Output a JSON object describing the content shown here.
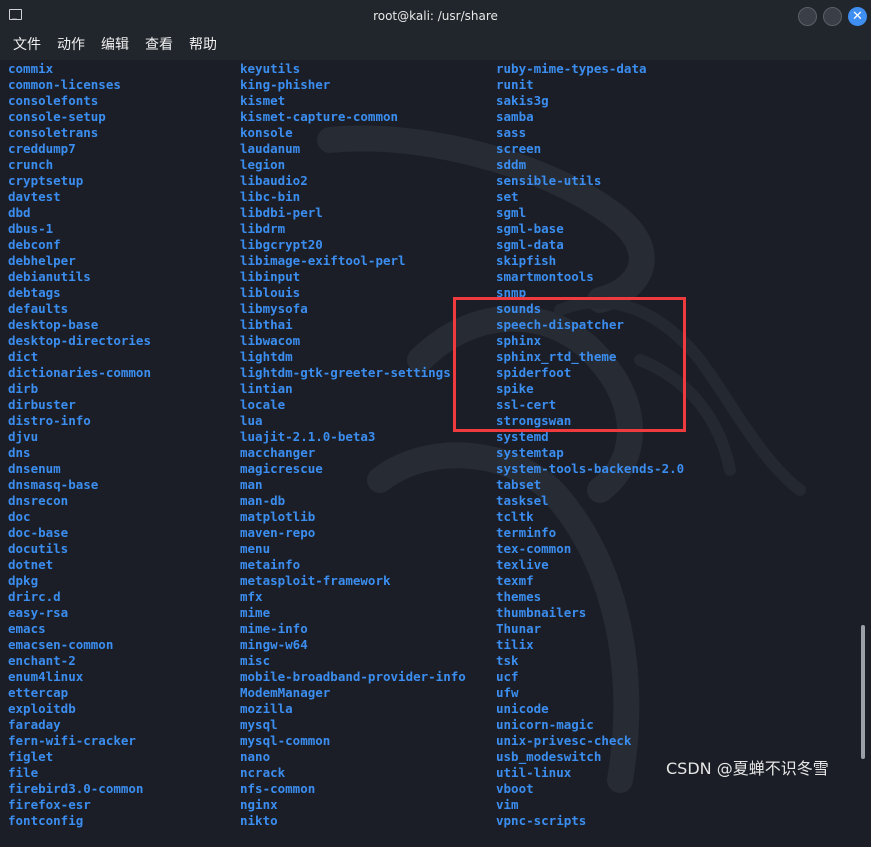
{
  "window": {
    "title": "root@kali: /usr/share",
    "app_icon": "terminal-icon",
    "buttons": [
      "minimize-button",
      "maximize-button",
      "close-button"
    ],
    "close_glyph": "✕"
  },
  "menu": {
    "items": [
      "文件",
      "动作",
      "编辑",
      "查看",
      "帮助"
    ]
  },
  "listing": {
    "color": "#3b8ef0",
    "col1": [
      "commix",
      "common-licenses",
      "consolefonts",
      "console-setup",
      "consoletrans",
      "creddump7",
      "crunch",
      "cryptsetup",
      "davtest",
      "dbd",
      "dbus-1",
      "debconf",
      "debhelper",
      "debianutils",
      "debtags",
      "defaults",
      "desktop-base",
      "desktop-directories",
      "dict",
      "dictionaries-common",
      "dirb",
      "dirbuster",
      "distro-info",
      "djvu",
      "dns",
      "dnsenum",
      "dnsmasq-base",
      "dnsrecon",
      "doc",
      "doc-base",
      "docutils",
      "dotnet",
      "dpkg",
      "drirc.d",
      "easy-rsa",
      "emacs",
      "emacsen-common",
      "enchant-2",
      "enum4linux",
      "ettercap",
      "exploitdb",
      "faraday",
      "fern-wifi-cracker",
      "figlet",
      "file",
      "firebird3.0-common",
      "firefox-esr",
      "fontconfig"
    ],
    "col2": [
      "keyutils",
      "king-phisher",
      "kismet",
      "kismet-capture-common",
      "konsole",
      "laudanum",
      "legion",
      "libaudio2",
      "libc-bin",
      "libdbi-perl",
      "libdrm",
      "libgcrypt20",
      "libimage-exiftool-perl",
      "libinput",
      "liblouis",
      "libmysofa",
      "libthai",
      "libwacom",
      "lightdm",
      "lightdm-gtk-greeter-settings",
      "lintian",
      "locale",
      "lua",
      "luajit-2.1.0-beta3",
      "macchanger",
      "magicrescue",
      "man",
      "man-db",
      "matplotlib",
      "maven-repo",
      "menu",
      "metainfo",
      "metasploit-framework",
      "mfx",
      "mime",
      "mime-info",
      "mingw-w64",
      "misc",
      "mobile-broadband-provider-info",
      "ModemManager",
      "mozilla",
      "mysql",
      "mysql-common",
      "nano",
      "ncrack",
      "nfs-common",
      "nginx",
      "nikto"
    ],
    "col3": [
      "ruby-mime-types-data",
      "runit",
      "sakis3g",
      "samba",
      "sass",
      "screen",
      "sddm",
      "sensible-utils",
      "set",
      "sgml",
      "sgml-base",
      "sgml-data",
      "skipfish",
      "smartmontools",
      "snmp",
      "sounds",
      "speech-dispatcher",
      "sphinx",
      "sphinx_rtd_theme",
      "spiderfoot",
      "spike",
      "ssl-cert",
      "strongswan",
      "systemd",
      "systemtap",
      "system-tools-backends-2.0",
      "tabset",
      "tasksel",
      "tcltk",
      "terminfo",
      "tex-common",
      "texlive",
      "texmf",
      "themes",
      "thumbnailers",
      "Thunar",
      "tilix",
      "tsk",
      "ucf",
      "ufw",
      "unicode",
      "unicorn-magic",
      "unix-privesc-check",
      "usb_modeswitch",
      "util-linux",
      "vboot",
      "vim",
      "vpnc-scripts"
    ]
  },
  "annotation": {
    "box_color": "#ef3b3d"
  },
  "watermark": "CSDN @夏蝉不识冬雪"
}
